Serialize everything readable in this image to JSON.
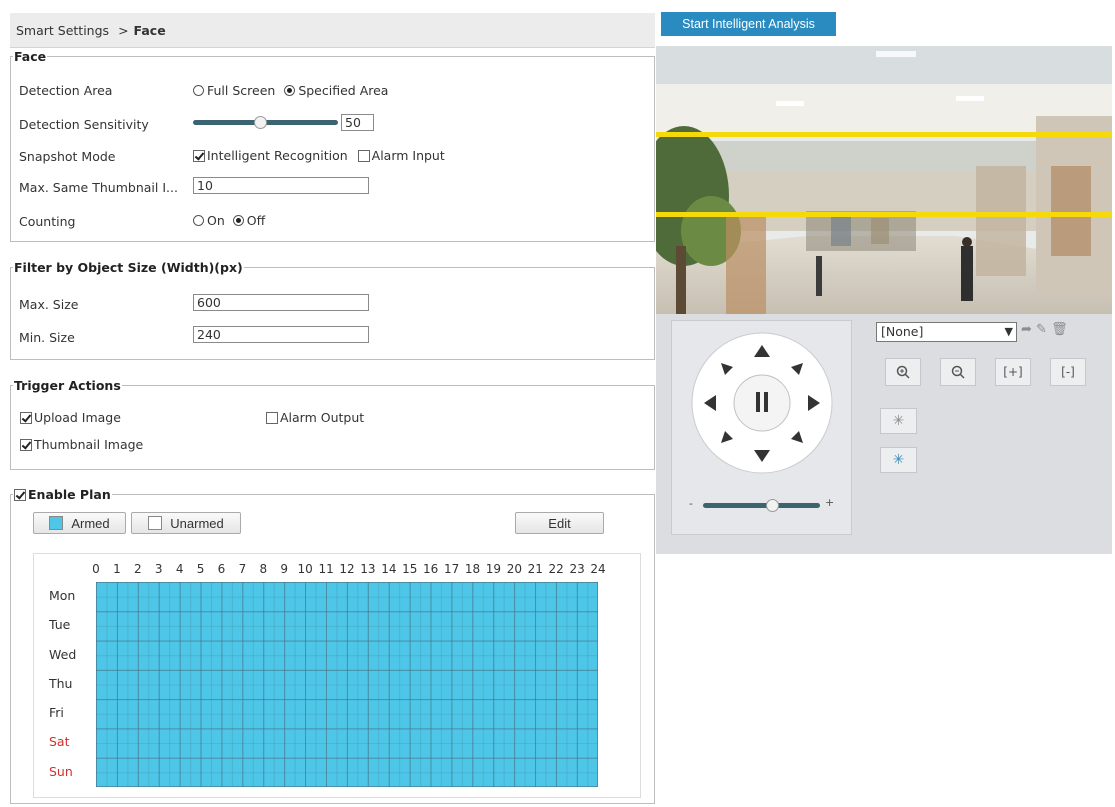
{
  "breadcrumb": {
    "parent": "Smart Settings",
    "separator": ">",
    "current": "Face"
  },
  "face": {
    "legend": "Face",
    "detection_area": {
      "label": "Detection Area",
      "opt1": "Full Screen",
      "opt2": "Specified Area",
      "selected": "Specified Area"
    },
    "sensitivity": {
      "label": "Detection Sensitivity",
      "value": "50",
      "level": 0.5
    },
    "snapshot": {
      "label": "Snapshot Mode",
      "opt1": "Intelligent Recognition",
      "opt1_checked": true,
      "opt2": "Alarm Input",
      "opt2_checked": false
    },
    "max_thumb": {
      "label": "Max. Same Thumbnail I...",
      "value": "10"
    },
    "counting": {
      "label": "Counting",
      "on": "On",
      "off": "Off",
      "selected": "Off"
    }
  },
  "filter": {
    "legend": "Filter by Object Size (Width)(px)",
    "max_label": "Max. Size",
    "max_value": "600",
    "min_label": "Min. Size",
    "min_value": "240"
  },
  "trigger": {
    "legend": "Trigger Actions",
    "upload": "Upload Image",
    "upload_checked": true,
    "alarm": "Alarm Output",
    "alarm_checked": false,
    "thumb": "Thumbnail Image",
    "thumb_checked": true
  },
  "plan": {
    "legend": "Enable Plan",
    "enabled": true,
    "armed": "Armed",
    "unarmed": "Unarmed",
    "edit": "Edit",
    "armed_color": "#4dc6e7",
    "hours": [
      "0",
      "1",
      "2",
      "3",
      "4",
      "5",
      "6",
      "7",
      "8",
      "9",
      "10",
      "11",
      "12",
      "13",
      "14",
      "15",
      "16",
      "17",
      "18",
      "19",
      "20",
      "21",
      "22",
      "23",
      "24"
    ],
    "days": [
      "Mon",
      "Tue",
      "Wed",
      "Thu",
      "Fri",
      "Sat",
      "Sun"
    ]
  },
  "analysis": {
    "start_label": "Start Intelligent Analysis",
    "button_color": "#2a8bc0",
    "line_color": "#f5d90a"
  },
  "ptz": {
    "preset_value": "[None]",
    "zoom_in_icon": "zoom-in-icon",
    "zoom_out_icon": "zoom-out-icon",
    "speed_minus": "-",
    "speed_plus": "+",
    "speed_level": 0.55
  }
}
